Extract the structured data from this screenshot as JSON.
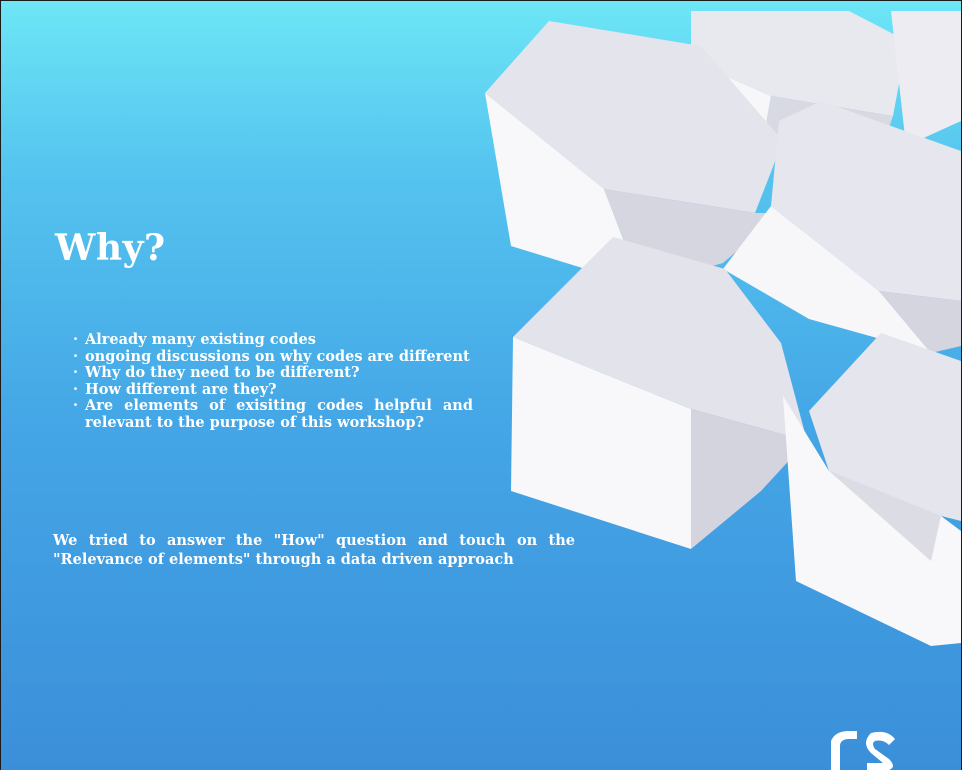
{
  "slide": {
    "title": "Why?",
    "bullets": [
      "Already many existing codes",
      "ongoing discussions on why codes are different",
      "Why do they need to be different?",
      "How different are they?",
      "Are elements of exisiting codes helpful and relevant to the purpose of this workshop?"
    ],
    "conclusion": "We tried to answer the \"How\" question and touch on the \"Relevance of elements\"  through a data driven approach"
  },
  "colors": {
    "background_top": "#6de6f6",
    "background_bottom": "#3b8fd9",
    "text": "#ffffff",
    "cube_top": "#e6e6ee",
    "cube_left": "#f6f6f9",
    "cube_right": "#d4d4de"
  }
}
